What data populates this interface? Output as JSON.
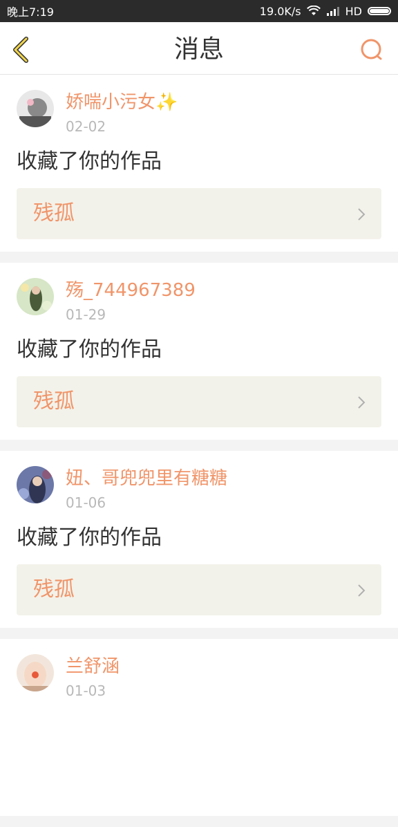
{
  "status_bar": {
    "time": "晚上7:19",
    "speed": "19.0K/s",
    "network": "HD"
  },
  "header": {
    "title": "消息",
    "accent_color": "#f0956a"
  },
  "messages": [
    {
      "username": "娇喘小污女✨",
      "date": "02-02",
      "action": "收藏了你的作品",
      "work_title": "残孤",
      "avatar_colors": [
        "#e8e8e8",
        "#8a8a8a"
      ]
    },
    {
      "username": "殇_744967389",
      "date": "01-29",
      "action": "收藏了你的作品",
      "work_title": "残孤",
      "avatar_colors": [
        "#d6e6c6",
        "#4a5b3a"
      ]
    },
    {
      "username": "妞、哥兜兜里有糖糖",
      "date": "01-06",
      "action": "收藏了你的作品",
      "work_title": "残孤",
      "avatar_colors": [
        "#6b78a8",
        "#2f3552"
      ]
    },
    {
      "username": "兰舒涵",
      "date": "01-03",
      "action": "",
      "work_title": "",
      "avatar_colors": [
        "#f2e6dc",
        "#c8a58c"
      ]
    }
  ]
}
